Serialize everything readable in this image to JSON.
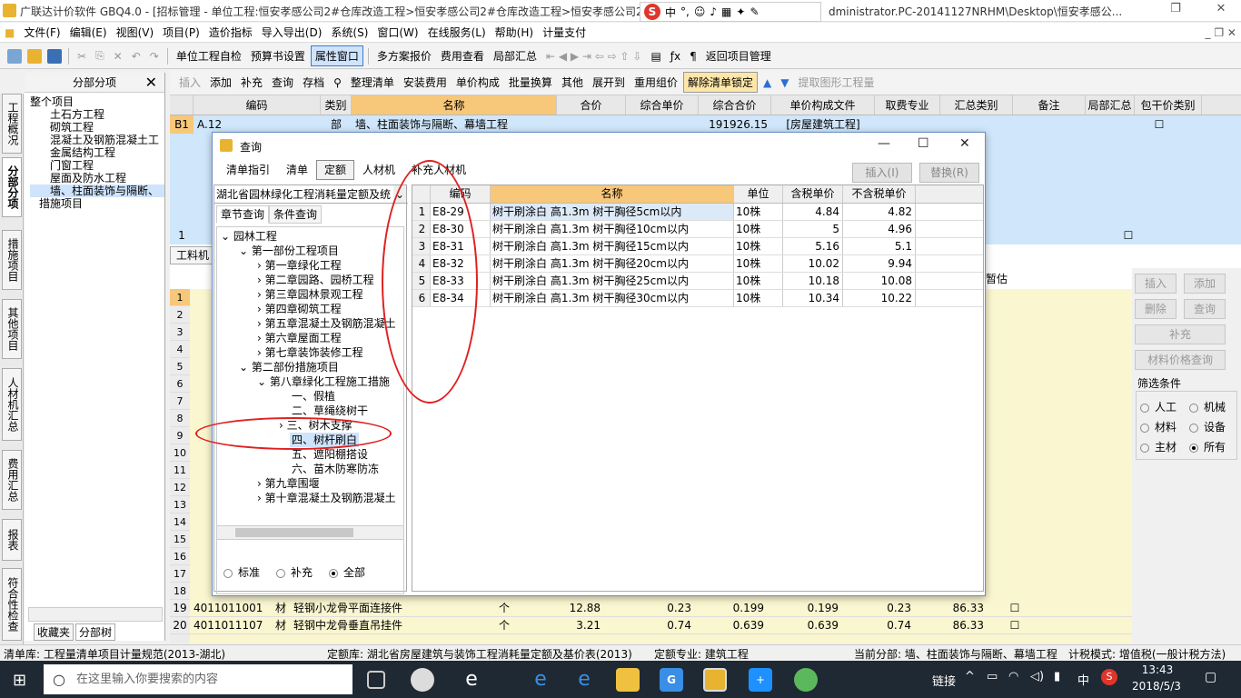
{
  "window": {
    "title": "广联达计价软件 GBQ4.0 - [招标管理 - 单位工程:恒安孝感公司2#仓库改造工程>恒安孝感公司2#仓库改造工程>恒安孝感公司2#",
    "title_tail": "dministrator.PC-20141127NRHM\\Desktop\\恒安孝感公..."
  },
  "ime": {
    "label": "中"
  },
  "menu": [
    "文件(F)",
    "编辑(E)",
    "视图(V)",
    "项目(P)",
    "造价指标",
    "导入导出(D)",
    "系统(S)",
    "窗口(W)",
    "在线服务(L)",
    "帮助(H)",
    "计量支付"
  ],
  "toolbar1": {
    "items": [
      "单位工程自检",
      "预算书设置",
      "属性窗口",
      "多方案报价",
      "费用查看",
      "局部汇总",
      "返回项目管理"
    ]
  },
  "toolbar2": {
    "items": [
      "插入",
      "添加",
      "补充",
      "查询",
      "存档",
      "整理清单",
      "安装费用",
      "单价构成",
      "批量换算",
      "其他",
      "展开到",
      "重用组价",
      "解除清单锁定",
      "提取图形工程量"
    ]
  },
  "left_rail": [
    "工程概况",
    "分部分项",
    "措施项目",
    "其他项目",
    "人材机汇总",
    "费用汇总",
    "报表",
    "符合性检查"
  ],
  "nav": {
    "title": "分部分项",
    "items": [
      "整个项目",
      "土石方工程",
      "砌筑工程",
      "混凝土及钢筋混凝土工",
      "金属结构工程",
      "门窗工程",
      "屋面及防水工程",
      "墙、柱面装饰与隔断、",
      "措施项目"
    ],
    "bottom_tabs": [
      "收藏夹",
      "分部树"
    ]
  },
  "main_headers": [
    "编码",
    "类别",
    "名称",
    "合价",
    "综合单价",
    "综合合价",
    "单价构成文件",
    "取费专业",
    "汇总类别",
    "备注",
    "局部汇总",
    "包干价类别"
  ],
  "main_row": {
    "id": "B1",
    "code": "A.12",
    "type": "部",
    "name": "墙、柱面装饰与隔断、幕墙工程",
    "total": "191926.15",
    "file": "[房屋建筑工程]"
  },
  "main_row2": {
    "id": "1"
  },
  "lower": {
    "tab": "工料机",
    "col_last": "暂估",
    "rows": [
      {
        "n": "19",
        "code": "4011011001",
        "type": "材",
        "name": "轻钢小龙骨平面连接件",
        "unit": "个",
        "q": "12.88",
        "a": "0.23",
        "b": "0.199",
        "c": "0.199",
        "d": "0.23",
        "e": "86.33"
      },
      {
        "n": "20",
        "code": "4011011107",
        "type": "材",
        "name": "轻钢中龙骨垂直吊挂件",
        "unit": "个",
        "q": "3.21",
        "a": "0.74",
        "b": "0.639",
        "c": "0.639",
        "d": "0.74",
        "e": "86.33"
      }
    ],
    "row_numbers": [
      "1",
      "2",
      "3",
      "4",
      "5",
      "6",
      "7",
      "8",
      "9",
      "10",
      "11",
      "12",
      "13",
      "14",
      "15",
      "16",
      "17",
      "18"
    ]
  },
  "right_panel": {
    "buttons": [
      "插入",
      "添加",
      "删除",
      "查询",
      "补充",
      "材料价格查询"
    ],
    "filter_title": "筛选条件",
    "filters": [
      "人工",
      "机械",
      "材料",
      "设备",
      "主材",
      "所有"
    ],
    "selected": "所有"
  },
  "dialog": {
    "title": "查询",
    "tabs": [
      "清单指引",
      "清单",
      "定额",
      "人材机",
      "补充人材机"
    ],
    "active_tab": "定额",
    "insert_btn": "插入(I)",
    "replace_btn": "替换(R)",
    "library": "湖北省园林绿化工程消耗量定额及统",
    "subtabs": [
      "章节查询",
      "条件查询"
    ],
    "tree": [
      "园林工程",
      "第一部份工程项目",
      "第一章绿化工程",
      "第二章园路、园桥工程",
      "第三章园林景观工程",
      "第四章砌筑工程",
      "第五章混凝土及钢筋混凝土",
      "第六章屋面工程",
      "第七章装饰装修工程",
      "第二部份措施项目",
      "第八章绿化工程施工措施",
      "一、假植",
      "二、草绳绕树干",
      "三、树木支撑",
      "四、树杆刷白",
      "五、遮阳棚搭设",
      "六、苗木防寒防冻",
      "第九章围堰",
      "第十章混凝土及钢筋混凝土"
    ],
    "radios": [
      "标准",
      "补充",
      "全部"
    ],
    "radio_selected": "全部",
    "grid_headers": [
      "编码",
      "名称",
      "单位",
      "含税单价",
      "不含税单价"
    ],
    "rows": [
      {
        "n": "1",
        "code": "E8-29",
        "name": "树干刷涂白 高1.3m 树干胸径5cm以内",
        "unit": "10株",
        "p1": "4.84",
        "p2": "4.82"
      },
      {
        "n": "2",
        "code": "E8-30",
        "name": "树干刷涂白 高1.3m 树干胸径10cm以内",
        "unit": "10株",
        "p1": "5",
        "p2": "4.96"
      },
      {
        "n": "3",
        "code": "E8-31",
        "name": "树干刷涂白 高1.3m 树干胸径15cm以内",
        "unit": "10株",
        "p1": "5.16",
        "p2": "5.1"
      },
      {
        "n": "4",
        "code": "E8-32",
        "name": "树干刷涂白 高1.3m 树干胸径20cm以内",
        "unit": "10株",
        "p1": "10.02",
        "p2": "9.94"
      },
      {
        "n": "5",
        "code": "E8-33",
        "name": "树干刷涂白 高1.3m 树干胸径25cm以内",
        "unit": "10株",
        "p1": "10.18",
        "p2": "10.08"
      },
      {
        "n": "6",
        "code": "E8-34",
        "name": "树干刷涂白 高1.3m 树干胸径30cm以内",
        "unit": "10株",
        "p1": "10.34",
        "p2": "10.22"
      }
    ]
  },
  "status": {
    "qd": "清单库: 工程量清单项目计量规范(2013-湖北)",
    "de": "定额库: 湖北省房屋建筑与装饰工程消耗量定额及基价表(2013)",
    "zy": "定额专业: 建筑工程",
    "fb": "当前分部: 墙、柱面装饰与隔断、幕墙工程",
    "mode": "计税模式: 增值税(一般计税方法)"
  },
  "taskbar": {
    "search_placeholder": "在这里输入你要搜索的内容",
    "link": "链接",
    "lang": "中",
    "time": "13:43",
    "date": "2018/5/3"
  }
}
